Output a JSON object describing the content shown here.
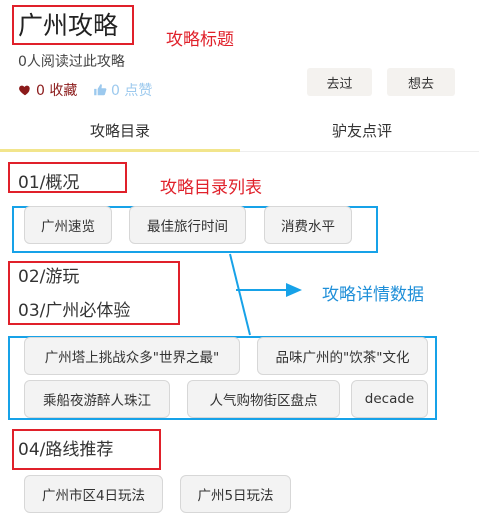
{
  "header": {
    "title": "广州攻略",
    "read_count": "0人阅读过此攻略",
    "favorite": "0 收藏",
    "like": "0 点赞",
    "btn_been": "去过",
    "btn_want": "想去"
  },
  "annotations": {
    "title_label": "攻略标题",
    "toc_label": "攻略目录列表",
    "detail_label": "攻略详情数据"
  },
  "tabs": [
    {
      "label": "攻略目录",
      "active": true
    },
    {
      "label": "驴友点评",
      "active": false
    }
  ],
  "sections": [
    {
      "title": "01/概况",
      "items": [
        "广州速览",
        "最佳旅行时间",
        "消费水平"
      ]
    },
    {
      "title": "02/游玩",
      "items": []
    },
    {
      "title": "03/广州必体验",
      "items": [
        "广州塔上挑战众多\"世界之最\"",
        "品味广州的\"饮茶\"文化",
        "乘船夜游醉人珠江",
        "人气购物街区盘点",
        "decade"
      ]
    },
    {
      "title": "04/路线推荐",
      "items": [
        "广州市区4日玩法",
        "广州5日玩法"
      ]
    }
  ],
  "colors": {
    "annotation_red": "#e0202a",
    "annotation_blue": "#17a2e8",
    "tab_indicator": "#f2e58c",
    "heart": "#8b1a1a",
    "like": "#9cc9ee"
  },
  "icons": {
    "favorite": "heart-icon",
    "like": "thumbs-up-icon",
    "arrow": "arrow-right-icon"
  }
}
